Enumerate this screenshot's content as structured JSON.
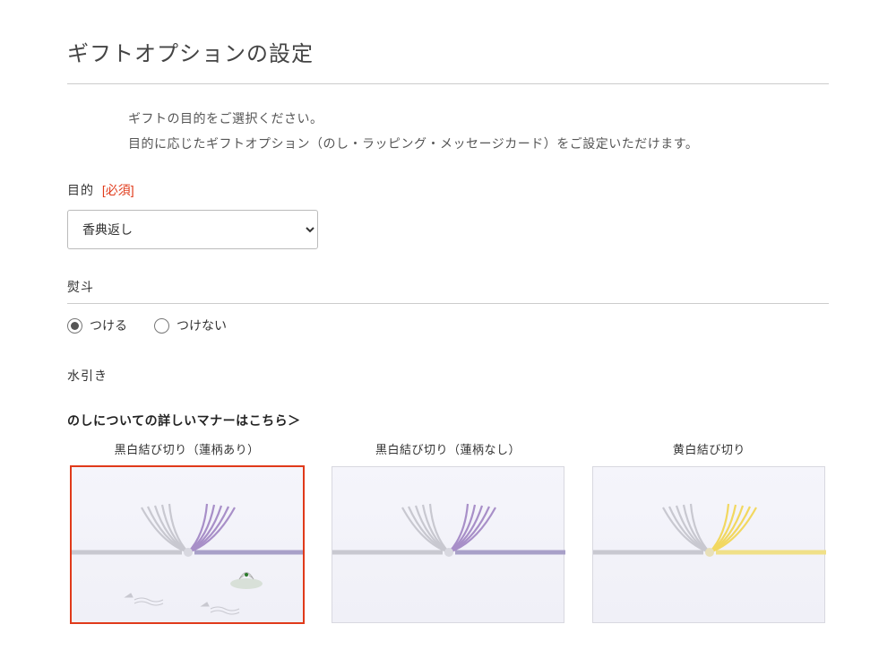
{
  "page": {
    "title": "ギフトオプションの設定",
    "intro_line1": "ギフトの目的をご選択ください。",
    "intro_line2": "目的に応じたギフトオプション（のし・ラッピング・メッセージカード）をご設定いただけます。"
  },
  "purpose": {
    "label": "目的",
    "required": "[必須]",
    "selected": "香典返し"
  },
  "noshi_toggle": {
    "label": "熨斗",
    "options": {
      "on": "つける",
      "off": "つけない"
    },
    "selected": "on"
  },
  "mizuhiki": {
    "label": "水引き",
    "link_text": "のしについての詳しいマナーはこちら＞",
    "options": [
      {
        "label": "黒白結び切り（蓮柄あり）",
        "type": "bw-lotus",
        "selected": true
      },
      {
        "label": "黒白結び切り（蓮柄なし）",
        "type": "bw",
        "selected": false
      },
      {
        "label": "黄白結び切り",
        "type": "yw",
        "selected": false
      }
    ]
  }
}
